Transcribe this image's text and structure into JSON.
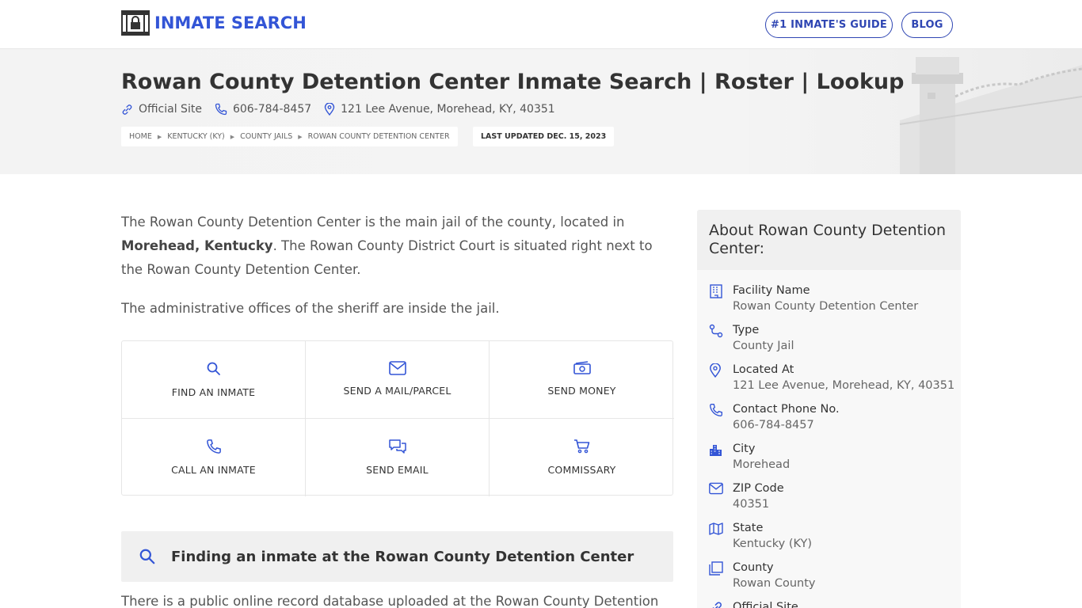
{
  "header": {
    "logo_text": "INMATE SEARCH",
    "nav": [
      {
        "label": "#1 INMATE'S GUIDE"
      },
      {
        "label": "BLOG"
      }
    ]
  },
  "hero": {
    "title": "Rowan County Detention Center Inmate Search | Roster | Lookup",
    "meta": {
      "official_site": "Official Site",
      "phone": "606-784-8457",
      "address": "121 Lee Avenue, Morehead, KY, 40351"
    },
    "breadcrumb": [
      "HOME",
      "KENTUCKY (KY)",
      "COUNTY JAILS",
      "ROWAN COUNTY DETENTION CENTER"
    ],
    "last_updated": "LAST UPDATED DEC. 15, 2023"
  },
  "main": {
    "intro_a": "The Rowan County Detention Center is the main jail of the county, located in ",
    "intro_bold": "Morehead, Kentucky",
    "intro_b": ". The Rowan County District Court is situated right next to the Rowan County Detention Center.",
    "intro2": "The administrative offices of the sheriff are inside the jail.",
    "actions": [
      {
        "label": "FIND AN INMATE",
        "icon": "search-icon"
      },
      {
        "label": "SEND A MAIL/PARCEL",
        "icon": "mail-icon"
      },
      {
        "label": "SEND MONEY",
        "icon": "money-icon"
      },
      {
        "label": "CALL AN INMATE",
        "icon": "phone-icon"
      },
      {
        "label": "SEND EMAIL",
        "icon": "chat-icon"
      },
      {
        "label": "COMMISSARY",
        "icon": "cart-icon"
      }
    ],
    "finding_heading": "Finding an inmate at the Rowan County Detention Center",
    "bottom_text": "There is a public online record database uploaded at the Rowan County Detention"
  },
  "sidebar": {
    "title": "About Rowan County Detention Center:",
    "rows": [
      {
        "label": "Facility Name",
        "value": "Rowan County Detention Center",
        "icon": "building-icon"
      },
      {
        "label": "Type",
        "value": "County Jail",
        "icon": "route-icon"
      },
      {
        "label": "Located At",
        "value": "121 Lee Avenue, Morehead, KY, 40351",
        "icon": "location-pin-icon"
      },
      {
        "label": "Contact Phone No.",
        "value": "606-784-8457",
        "icon": "phone-icon"
      },
      {
        "label": "City",
        "value": "Morehead",
        "icon": "city-icon"
      },
      {
        "label": "ZIP Code",
        "value": "40351",
        "icon": "envelope-icon"
      },
      {
        "label": "State",
        "value": "Kentucky (KY)",
        "icon": "map-icon"
      },
      {
        "label": "County",
        "value": "Rowan County",
        "icon": "layers-icon"
      },
      {
        "label": "Official Site",
        "value": "",
        "icon": "link-icon"
      }
    ]
  },
  "colors": {
    "accent": "#3355d6",
    "nav_border": "#2f46b3",
    "hero_bg": "#f3f3f3",
    "box_bg": "#f0f0f0"
  }
}
